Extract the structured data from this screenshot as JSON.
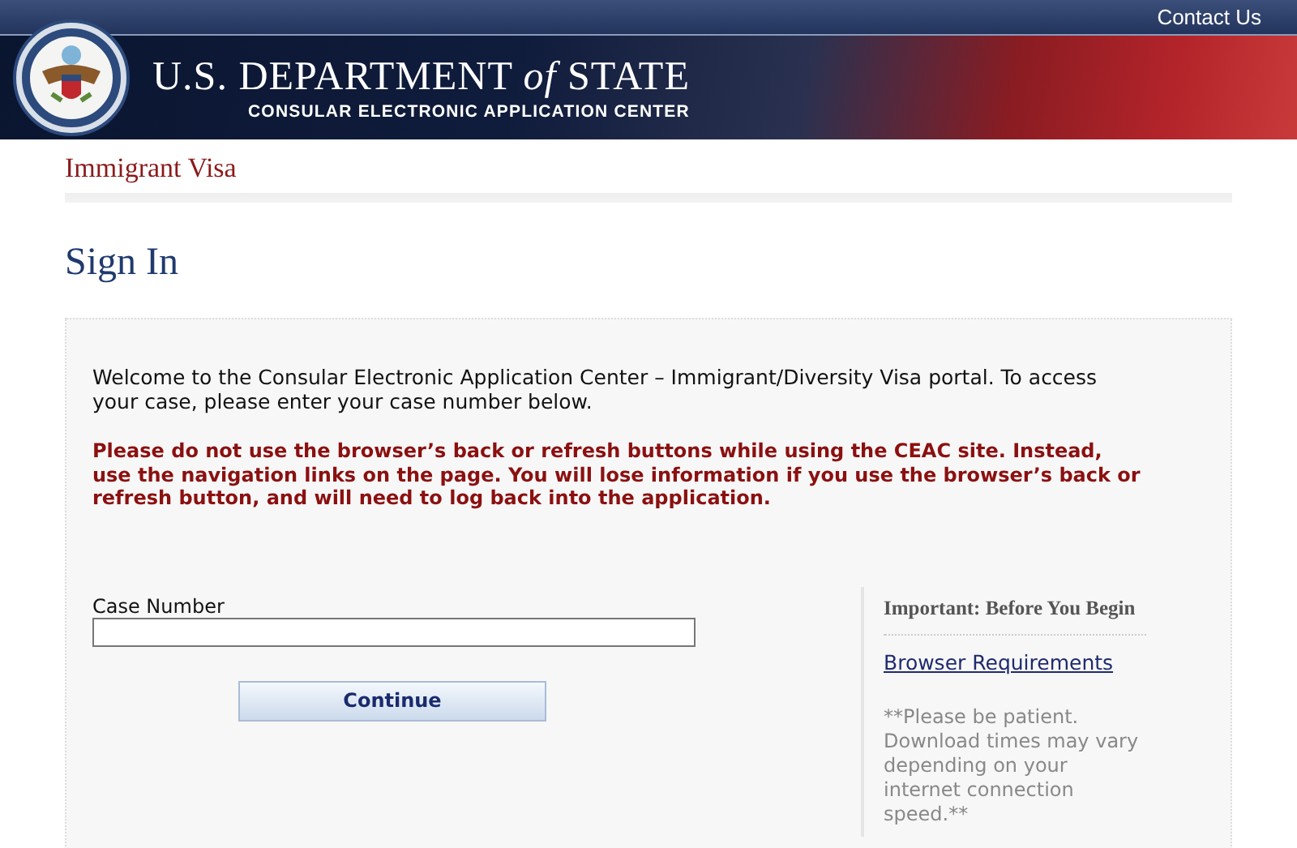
{
  "header": {
    "contact_link": "Contact Us",
    "title": "U.S. DEPARTMENT *of* STATE",
    "subtitle": "CONSULAR ELECTRONIC APPLICATION CENTER"
  },
  "section_title": "Immigrant Visa",
  "page_title": "Sign In",
  "panel": {
    "intro": "Welcome to the Consular Electronic Application Center – Immigrant/Diversity Visa portal. To access your case, please enter your case number below.",
    "warning": "Please do not use the browser’s back or refresh buttons while using the CEAC site. Instead, use the navigation links on the page. You will lose information if you use the browser’s back or refresh button, and will need to log back into the application.",
    "form": {
      "label": "Case Number",
      "button": "Continue"
    },
    "sidebar": {
      "heading": "**Important:** Before You Begin",
      "link": "Browser Requirements",
      "note": "**Please be patient. Download times may vary depending on your internet connection speed.**"
    }
  }
}
